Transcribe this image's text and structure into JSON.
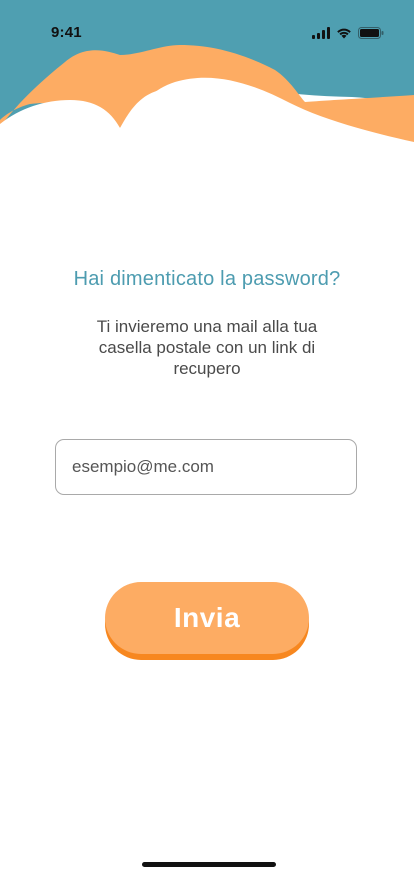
{
  "status_bar": {
    "time": "9:41",
    "icons": [
      "cellular-signal-icon",
      "wifi-icon",
      "battery-icon"
    ]
  },
  "colors": {
    "header_teal": "#4f9fb1",
    "accent_orange": "#fdac63",
    "button_shadow": "#f7871f",
    "title_color": "#4d9cb0"
  },
  "main": {
    "title": "Hai dimenticato la password?",
    "description": "Ti invieremo una mail alla tua casella postale con un link di recupero",
    "email_placeholder": "esempio@me.com",
    "email_value": "",
    "submit_label": "Invia"
  }
}
